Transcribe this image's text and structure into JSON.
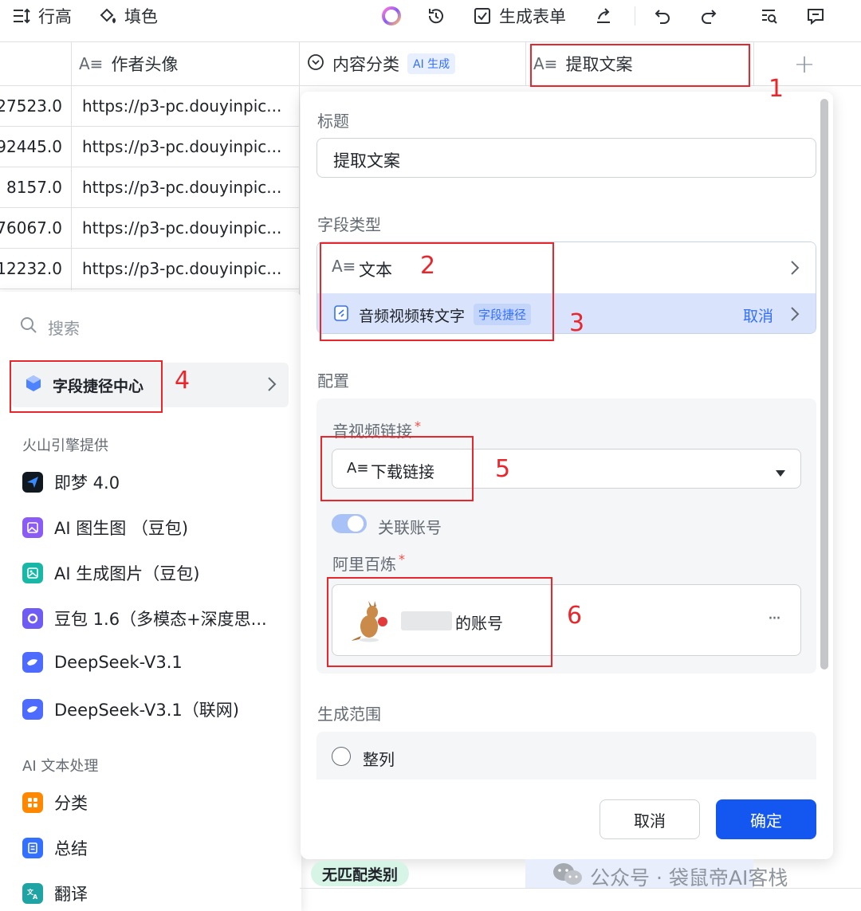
{
  "toolbar": {
    "row_height": "行高",
    "fill_color": "填色",
    "generate_form": "生成表单"
  },
  "columns": {
    "author_avatar": "作者头像",
    "content_category": "内容分类",
    "ai_badge": "AI 生成",
    "extract_copy": "提取文案"
  },
  "rows": [
    {
      "num": "27523.0",
      "url": "https://p3-pc.douyinpic..."
    },
    {
      "num": "92445.0",
      "url": "https://p3-pc.douyinpic..."
    },
    {
      "num": "8157.0",
      "url": "https://p3-pc.douyinpic..."
    },
    {
      "num": "76067.0",
      "url": "https://p3-pc.douyinpic..."
    },
    {
      "num": "12232.0",
      "url": "https://p3-pc.douyinpic..."
    }
  ],
  "left_panel": {
    "search_placeholder": "搜索",
    "shortcut_center": "字段捷径中心",
    "section_volcano": "火山引擎提供",
    "section_ai_text": "AI 文本处理",
    "items": [
      {
        "label": "即梦 4.0",
        "icon": "jimeng-icon",
        "color": "#101820"
      },
      {
        "label": "AI 图生图 （豆包)",
        "icon": "image-to-image-icon",
        "color": "#8a5cf5"
      },
      {
        "label": "AI 生成图片（豆包)",
        "icon": "generate-image-icon",
        "color": "#19b8a6"
      },
      {
        "label": "豆包 1.6（多模态+深度思...",
        "icon": "doubao-icon",
        "color": "#6f5cf5"
      },
      {
        "label": "DeepSeek-V3.1",
        "icon": "deepseek-icon",
        "color": "#4d6bfe"
      },
      {
        "label": "DeepSeek-V3.1（联网)",
        "icon": "deepseek-icon",
        "color": "#4d6bfe"
      },
      {
        "label": "分类",
        "icon": "classify-icon",
        "color": "#ff8800"
      },
      {
        "label": "总结",
        "icon": "summary-icon",
        "color": "#3370ff"
      },
      {
        "label": "翻译",
        "icon": "translate-icon",
        "color": "#1fa3a3"
      }
    ]
  },
  "config": {
    "title_label": "标题",
    "title_value": "提取文案",
    "field_type_label": "字段类型",
    "field_type_value": "文本",
    "shortcut_value": "音频视频转文字",
    "shortcut_badge": "字段捷径",
    "shortcut_cancel": "取消",
    "config_label": "配置",
    "media_link_label": "音视频链接",
    "required_mark": "*",
    "media_link_value": "下载链接",
    "link_account_label": "关联账号",
    "bailian_label": "阿里百炼",
    "account_suffix": "的账号",
    "more_glyph": "···",
    "range_label": "生成范围",
    "range_value": "整列",
    "cancel_button": "取消",
    "confirm_button": "确定"
  },
  "annotations": [
    "1",
    "2",
    "3",
    "4",
    "5",
    "6"
  ],
  "bottom": {
    "no_match_tag": "无匹配类别",
    "watermark": "公众号 · 袋鼠帝AI客栈"
  },
  "colors": {
    "primary": "#1456f0",
    "annotation_red": "#e8262c",
    "shortcut_bg": "#d9e3fb"
  }
}
